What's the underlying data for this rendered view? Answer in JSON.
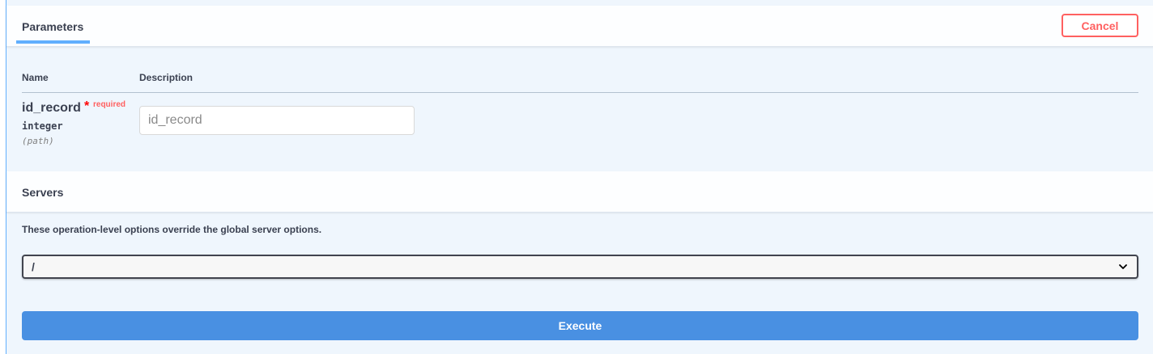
{
  "parameters_section": {
    "tab_label": "Parameters",
    "cancel_label": "Cancel",
    "columns": {
      "name": "Name",
      "description": "Description"
    },
    "params": [
      {
        "name": "id_record",
        "required_star": "*",
        "required_label": "required",
        "type": "integer",
        "in": "(path)",
        "placeholder": "id_record",
        "value": ""
      }
    ]
  },
  "servers_section": {
    "title": "Servers",
    "note": "These operation-level options override the global server options.",
    "selected_server": "/"
  },
  "execute_label": "Execute",
  "icons": {
    "select_arrow": "chevron-down-icon"
  },
  "colors": {
    "accent_blue": "#61affe",
    "cancel_red": "#ff6060",
    "execute_blue": "#4990e2",
    "panel_bg": "#eff6fd"
  }
}
